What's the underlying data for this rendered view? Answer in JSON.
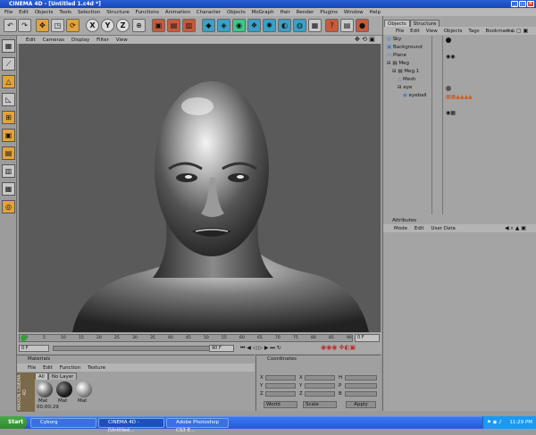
{
  "window": {
    "title": "CINEMA 4D - [Untitled 1.c4d *]",
    "min": "_",
    "max": "□",
    "close": "×"
  },
  "menu": [
    "File",
    "Edit",
    "Objects",
    "Tools",
    "Selection",
    "Structure",
    "Functions",
    "Animation",
    "Character",
    "Objects",
    "MoGraph",
    "Hair",
    "Render",
    "Plugins",
    "Window",
    "Help"
  ],
  "toolbar": {
    "icons": [
      "undo-icon",
      "redo-icon",
      "move-icon",
      "scale-icon",
      "rotate-icon",
      "x-axis-icon",
      "y-axis-icon",
      "z-axis-icon",
      "world-icon",
      "render-view-icon",
      "render-icon",
      "render-settings-icon",
      "cube-icon",
      "spline-icon",
      "nurbs-icon",
      "array-icon",
      "deformer-icon",
      "scene-icon",
      "light-icon",
      "camera-icon",
      "help-icon",
      "layout-icon",
      "material-icon"
    ],
    "x_label": "X",
    "y_label": "Y",
    "z_label": "Z"
  },
  "viewport": {
    "menu": [
      "Edit",
      "Cameras",
      "Display",
      "Filter",
      "View"
    ]
  },
  "timeline": {
    "ticks": [
      "0",
      "5",
      "10",
      "15",
      "20",
      "25",
      "30",
      "35",
      "40",
      "45",
      "50",
      "55",
      "60",
      "65",
      "70",
      "75",
      "80",
      "85",
      "90"
    ],
    "frame_value": "0 F",
    "start_field": "0 F",
    "end_field": "90 F",
    "current": "0 F"
  },
  "material": {
    "title": "Materials",
    "menu": [
      "File",
      "Edit",
      "Function",
      "Texture"
    ],
    "tabs": [
      "All",
      "No Layer"
    ],
    "items": [
      "Mat",
      "Mat",
      "Mat"
    ],
    "timecode": "00:00:29",
    "brand": "MAXON CINEMA 4D"
  },
  "coordinates": {
    "title": "Coordinates",
    "rows": [
      [
        "X",
        "X",
        "H"
      ],
      [
        "Y",
        "Y",
        "P"
      ],
      [
        "Z",
        "Z",
        "B"
      ]
    ],
    "world": "World",
    "scale": "Scale",
    "apply": "Apply"
  },
  "objects": {
    "tabs": [
      "Objects",
      "Structure"
    ],
    "menu": [
      "File",
      "Edit",
      "View",
      "Objects",
      "Tags",
      "Bookmarks"
    ],
    "rows": [
      "Sky",
      "Background",
      "Plane",
      "Meg",
      "Meg.1",
      "Mesh",
      "eye",
      "eyeball"
    ]
  },
  "attributes": {
    "title": "Attributes",
    "menu": [
      "Mode",
      "Edit",
      "User Data"
    ]
  },
  "taskbar": {
    "start": "Start",
    "tasks": [
      "Cyborg",
      "CINEMA 4D - [Untitled...",
      "Adobe Photoshop CS3 E..."
    ],
    "time": "11:29 PM"
  }
}
